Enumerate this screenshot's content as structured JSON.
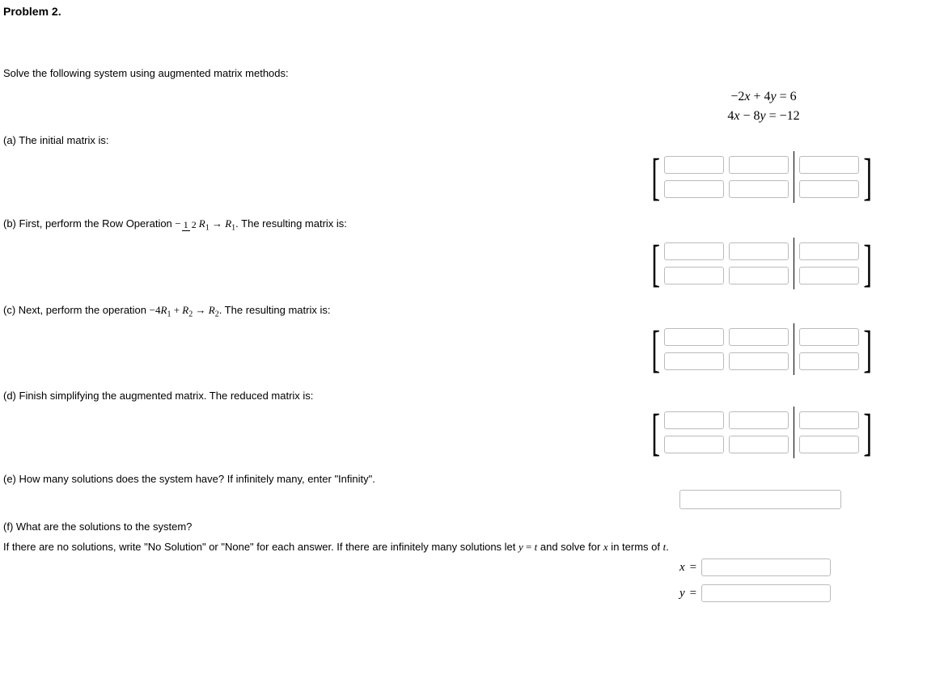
{
  "title": "Problem 2.",
  "instruction": "Solve the following system using augmented matrix methods:",
  "equations": {
    "line1": "−2x + 4y = 6",
    "line2": "4x − 8y = −12"
  },
  "parts": {
    "a": "(a) The initial matrix is:",
    "b_prefix": "(b) First, perform the Row Operation ",
    "b_suffix": ". The resulting matrix is:",
    "b_frac_top": "1",
    "b_frac_bot": "2",
    "b_frac_sign": "−",
    "b_R1": "R",
    "b_sub1": "1",
    "b_arrow": " → ",
    "b_R1b": "R",
    "b_sub1b": "1",
    "c_prefix": "(c) Next, perform the operation ",
    "c_op": "−4R",
    "c_sub1": "1",
    "c_plus": " + R",
    "c_sub2": "2",
    "c_arrow": " → R",
    "c_sub2b": "2",
    "c_suffix": ". The resulting matrix is:",
    "d": "(d) Finish simplifying the augmented matrix. The reduced matrix is:",
    "e": "(e) How many solutions does the system have? If infinitely many, enter \"Infinity\".",
    "f1": "(f) What are the solutions to the system?",
    "f2_prefix": "If there are no solutions, write \"No Solution\" or \"None\" for each answer. If there are infinitely many solutions let ",
    "f2_mid": " and solve for ",
    "f2_suffix": " in terms of ",
    "f2_end": ".",
    "y_eq_t": "y = t",
    "var_x": "x",
    "var_t": "t"
  },
  "labels": {
    "x_eq": "x =",
    "y_eq": "y ="
  }
}
